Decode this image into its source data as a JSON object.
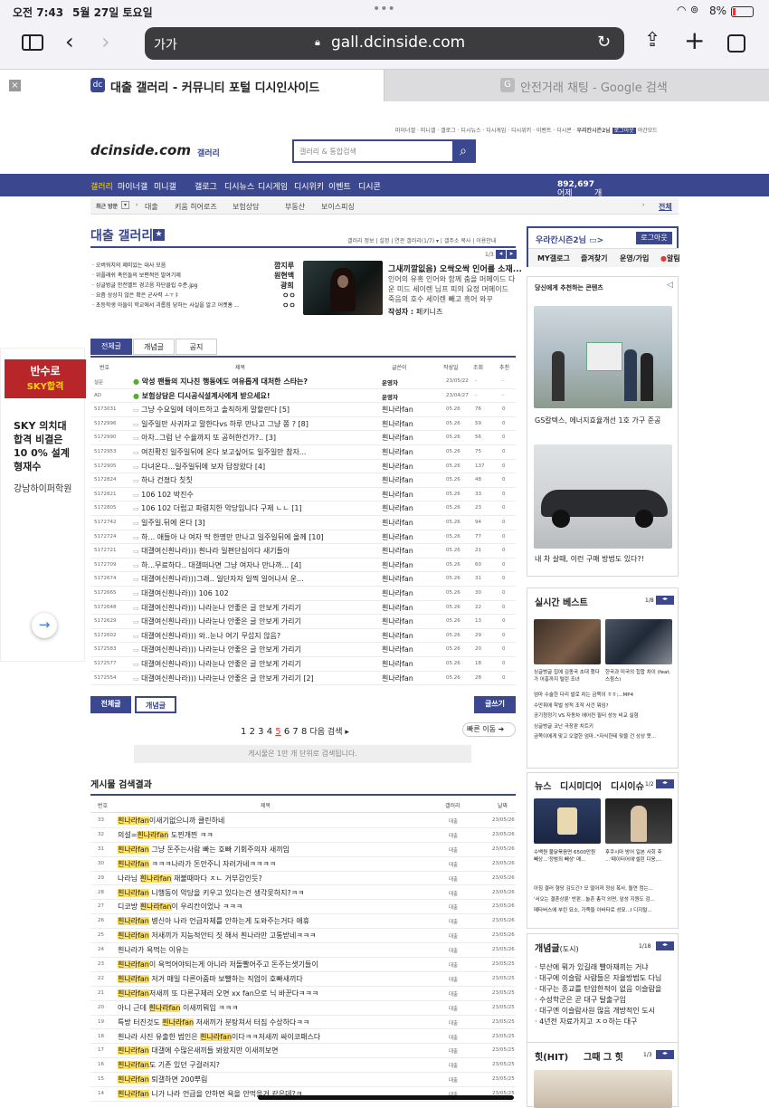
{
  "status": {
    "time": "오전 7:43",
    "date": "5월 27일 토요일",
    "dots": "•••",
    "battery": "8%"
  },
  "browser": {
    "aa": "가가",
    "url": "gall.dcinside.com"
  },
  "tabs": [
    {
      "title": "대출 갤러리 - 커뮤니티 포털 디시인사이드"
    },
    {
      "title": "안전거래 채팅 - Google 검색"
    }
  ],
  "header": {
    "toplinks": [
      "마이너갤",
      "미니갤",
      "갤로그",
      "디시뉴스",
      "디시게임",
      "디시위키",
      "이벤트",
      "디시콘",
      "우리칸시즌2님",
      "로그아웃",
      "야간모드"
    ],
    "logo": "dcinside.com",
    "logo_sub": "갤러리",
    "search_placeholder": "갤러리 & 통합검색"
  },
  "nav": {
    "items": [
      "갤러리",
      "마이너갤",
      "미니갤",
      "갤로그",
      "디시뉴스",
      "디시게임",
      "디시위키",
      "이벤트",
      "디시콘"
    ],
    "today_prefix": "어제",
    "today_count": "892,697",
    "today_suffix": "개 게시글 등록"
  },
  "recent": {
    "label": "최근 방문",
    "items": [
      "대출",
      "키움 히어로즈",
      "보험상담",
      "부동산",
      "보이스피싱"
    ],
    "all": "전체"
  },
  "gallery": {
    "title": "대출 갤러리",
    "links": [
      "갤러리 정보",
      "설정",
      "연관 갤러리(1/7)",
      "갤주소 복사",
      "이용안내"
    ],
    "page": "1/3",
    "issues": [
      {
        "t": "오버워치의 제미있는 대사 모음",
        "a": "깜지루"
      },
      {
        "t": "위플래쉬 촉인들의 보편적인 발여기제",
        "a": "원현맥"
      },
      {
        "t": "싱글벙글 안전벨트 경고음 차단클립 수준.jpg",
        "a": "광희"
      },
      {
        "t": "요즘 상상치 않은 확은 군사력 ㅗㅜㅑ",
        "a": "ㅇㅇ"
      },
      {
        "t": "초등학생 아들이 학교에서 괴롭힘 당하는 사실을 알고 어켓홈 ...",
        "a": "ㅇㅇ"
      }
    ],
    "feature": {
      "title": "그새끼깔잆음) 오싹오싹 인어를 소재...",
      "body": "인어의 유혹 인어와 함께 춤을 머메이드 다운 미드 세이렌 님프 피의 요정 머메이드 죽음의 호수 세이렌 빼고 흑어 와꾸",
      "author_label": "작성자 : ",
      "author": "페키니즈"
    }
  },
  "tabs_list": [
    "전체글",
    "개념글",
    "공지"
  ],
  "cols": [
    "번호",
    "제목",
    "글쓴이",
    "작성일",
    "조회",
    "추천"
  ],
  "posts": [
    {
      "no": "설문",
      "t": "악성 팬들의 지나친 행동에도 여유롭게 대처한 스타는?",
      "w": "운영자",
      "d": "23/05/22",
      "v": "-",
      "r": "-",
      "b": true
    },
    {
      "no": "AD",
      "t": "보험상담은 디시공식설계사에게 받으세요!",
      "w": "운영자",
      "d": "23/04/27",
      "v": "-",
      "r": "-",
      "b": true
    },
    {
      "no": "5173031",
      "t": "그냥 수요일에 데이트하고 솔직하게 말할란다 [5]",
      "w": "흰나라fan",
      "d": "05.26",
      "v": "76",
      "r": "0"
    },
    {
      "no": "5172996",
      "t": "일주일만 사귀자고 말한다vs 하루 만나고 그냥 쫑 ? [8]",
      "w": "흰나라fan",
      "d": "05.26",
      "v": "59",
      "r": "0"
    },
    {
      "no": "5172990",
      "t": "아차..그럼 난 수율까지 또 공허한건가?.. [3]",
      "w": "흰나라fan",
      "d": "05.26",
      "v": "56",
      "r": "0"
    },
    {
      "no": "5172953",
      "t": "여친확진 일주일뒤에 온다 보고싶어도 일주일만 참자...",
      "w": "흰나라fan",
      "d": "05.26",
      "v": "75",
      "r": "0"
    },
    {
      "no": "5172905",
      "t": "다녀온다...일주일뒤에 보자 답장왔다 [4]",
      "w": "흰나라fan",
      "d": "05.26",
      "v": "137",
      "r": "0"
    },
    {
      "no": "5172824",
      "t": "하나 건졌다 칫칫",
      "w": "흰나라fan",
      "d": "05.26",
      "v": "48",
      "r": "0"
    },
    {
      "no": "5172821",
      "t": "106 102 박진수",
      "w": "흰나라fan",
      "d": "05.26",
      "v": "33",
      "r": "0"
    },
    {
      "no": "5172805",
      "t": "106 102 더럽고 파렴치한 악당입니다 구제 ㄴㄴ [1]",
      "w": "흰나라fan",
      "d": "05.26",
      "v": "23",
      "r": "0"
    },
    {
      "no": "5172742",
      "t": "일주일.뒤에 온다 [3]",
      "w": "흰나라fan",
      "d": "05.26",
      "v": "94",
      "r": "0"
    },
    {
      "no": "5172724",
      "t": "하... 애들아 나 여자 딱 한명만 만나고 일주일뒤에 올께 [10]",
      "w": "흰나라fan",
      "d": "05.26",
      "v": "77",
      "r": "0"
    },
    {
      "no": "5172721",
      "t": "대갤여신흰나라))) 흰나라 일편단심이다 새기들아",
      "w": "흰나라fan",
      "d": "05.26",
      "v": "21",
      "r": "0"
    },
    {
      "no": "5172709",
      "t": "하...무료하다.. 대갤떠나면 그냥 여자나 만나까... [4]",
      "w": "흰나라fan",
      "d": "05.26",
      "v": "60",
      "r": "0"
    },
    {
      "no": "5172674",
      "t": "대갤여신흰나라)))그래.. 일단자자 일찍 일어나서 운...",
      "w": "흰나라fan",
      "d": "05.26",
      "v": "31",
      "r": "0"
    },
    {
      "no": "5172665",
      "t": "대갤여신흰나라))) 106 102",
      "w": "흰나라fan",
      "d": "05.26",
      "v": "30",
      "r": "0"
    },
    {
      "no": "5172648",
      "t": "대갤여신흰나라))) 나라눈나 안좋은 글 안보게 가리기",
      "w": "흰나라fan",
      "d": "05.26",
      "v": "22",
      "r": "0"
    },
    {
      "no": "5172629",
      "t": "대갤여신흰나라))) 나라눈나 안좋은 글 안보게 가리기",
      "w": "흰나라fan",
      "d": "05.26",
      "v": "13",
      "r": "0"
    },
    {
      "no": "5172602",
      "t": "대갤여신흰나라))) 와..눈나 여기 무섭지 않음?",
      "w": "흰나라fan",
      "d": "05.26",
      "v": "29",
      "r": "0"
    },
    {
      "no": "5172583",
      "t": "대갤여신흰나라))) 나라눈나 안좋은 글 안보게 가리기",
      "w": "흰나라fan",
      "d": "05.26",
      "v": "20",
      "r": "0"
    },
    {
      "no": "5172577",
      "t": "대갤여신흰나라))) 나라눈나 안좋은 글 안보게 가리기",
      "w": "흰나라fan",
      "d": "05.26",
      "v": "18",
      "r": "0"
    },
    {
      "no": "5172554",
      "t": "대갤여신흰나라))) 나라눈나 안좋은 글 안보게 가리기 [2]",
      "w": "흰나라fan",
      "d": "05.26",
      "v": "28",
      "r": "0"
    }
  ],
  "list_buttons": {
    "all": "전체글",
    "concept": "개념글",
    "write": "글쓰기"
  },
  "pagination": {
    "pages": [
      "1",
      "2",
      "3",
      "4",
      "5",
      "6",
      "7",
      "8"
    ],
    "current": "5",
    "next": "다음 검색 ▸",
    "jump": "빠른 이동"
  },
  "notice": "게시물은 1만 개 단위로 검색됩니다.",
  "search_results": {
    "title": "게시물 검색결과",
    "cols": [
      "번호",
      "제목",
      "갤러리",
      "날짜"
    ],
    "rows": [
      {
        "no": "33",
        "pre": "",
        "hl": "흰나라fan",
        "post": "이새기없으니까 클린하네",
        "g": "대출",
        "d": "23/05/26"
      },
      {
        "no": "32",
        "pre": "의설=",
        "hl": "흰나라fan",
        "post": " 도찐개찐 ㅋㅋ",
        "g": "대출",
        "d": "23/05/26"
      },
      {
        "no": "31",
        "pre": "",
        "hl": "흰나라fan",
        "post": " 그냥 돈주는사람 빠는 호빠 기회주의자 새끼임",
        "g": "대출",
        "d": "23/05/26"
      },
      {
        "no": "30",
        "pre": "",
        "hl": "흰나라fan",
        "post": " ㅋㅋㅋ나라가 돈안주니 자러가네ㅋㅋㅋㅋ",
        "g": "대출",
        "d": "23/05/26"
      },
      {
        "no": "29",
        "pre": "나라님 ",
        "hl": "흰나라fan",
        "post": " 재불때마다 ㅈㄴ 거부감인듯?",
        "g": "대출",
        "d": "23/05/26"
      },
      {
        "no": "28",
        "pre": "",
        "hl": "흰나라fan",
        "post": " 니행동이 악당을 키우고 있다는건 생각못하지?ㅋㅋ",
        "g": "대출",
        "d": "23/05/26"
      },
      {
        "no": "27",
        "pre": "디코방 ",
        "hl": "흰나라fan",
        "post": "이 우리칸이었나 ㅋㅋㅋ",
        "g": "대출",
        "d": "23/05/26"
      },
      {
        "no": "26",
        "pre": "",
        "hl": "흰나라fan",
        "post": " 병신아 나라 언급자체를 안하는게 도와주는거다 애휴",
        "g": "대출",
        "d": "23/05/26"
      },
      {
        "no": "25",
        "pre": "",
        "hl": "흰나라fan",
        "post": " 저새끼가 지능적안티 짓 해서 흰나라만 고통받네ㅋㅋㅋ",
        "g": "대출",
        "d": "23/05/26"
      },
      {
        "no": "24",
        "pre": "흰나라가 욕먹는 이유는",
        "hl": "",
        "post": "",
        "g": "대출",
        "d": "23/05/26"
      },
      {
        "no": "23",
        "pre": "",
        "hl": "흰나라fan",
        "post": "이 욕먹어야되는게 아니라 저돌빨어주고 돈주는샛기들이",
        "g": "대출",
        "d": "23/05/25"
      },
      {
        "no": "22",
        "pre": "",
        "hl": "흰나라fan",
        "post": " 저거 매일 다른아줌마 보빨하는 직업이 호빠새끼다",
        "g": "대출",
        "d": "23/05/25"
      },
      {
        "no": "21",
        "pre": "",
        "hl": "흰나라fan",
        "post": "저새끼 또 다른구제러 오면 xx fan으로 닉 바꾼다ㅋㅋㅋ",
        "g": "대출",
        "d": "23/05/25"
      },
      {
        "no": "20",
        "pre": "아니 근데 ",
        "hl": "흰나라fan",
        "post": " 이새끼뭐임 ㅋㅋㅋ",
        "g": "대출",
        "d": "23/05/25"
      },
      {
        "no": "19",
        "pre": "특방 터진것도 ",
        "hl": "흰나라fan",
        "post": " 저새끼가 분탕쳐서 터짐 수상하다ㅋㅋ",
        "g": "대출",
        "d": "23/05/25"
      },
      {
        "no": "18",
        "pre": "흰나라 사진 유출한 범인은 ",
        "hl": "흰나라fan",
        "post": "이다ㅋㅋ저새끼 싸이코패스다",
        "g": "대출",
        "d": "23/05/25"
      },
      {
        "no": "17",
        "pre": "",
        "hl": "흰나라fan",
        "post": " 대갤에 수많은새끼들 봐왔지만 이새끼보면",
        "g": "대출",
        "d": "23/05/25"
      },
      {
        "no": "16",
        "pre": "",
        "hl": "흰나라fan",
        "post": "도 기존 있던 구걸러지?",
        "g": "대출",
        "d": "23/05/25"
      },
      {
        "no": "15",
        "pre": "",
        "hl": "흰나라fan",
        "post": " 퇴갤하면 200뿌림",
        "g": "대출",
        "d": "23/05/25"
      },
      {
        "no": "14",
        "pre": "",
        "hl": "흰나라fan",
        "post": " 니가 나라 언급을 안하면 욕을 안먹을거 같은데?ㅋ",
        "g": "대출",
        "d": "23/05/25"
      }
    ]
  },
  "left_ad": {
    "badge1": "반수로",
    "badge2": "SKY합격",
    "text": "SKY 의치대 합격 비결은 10 0% 설계형재수",
    "sub": "강남하이퍼학원"
  },
  "sidebar": {
    "user": "우라칸시즌2님",
    "logout": "로그아웃",
    "tabs": [
      "MY갤로그",
      "즐겨찾기",
      "운영/가입",
      "알림"
    ],
    "rec_title": "당신에게 추천하는 콘텐츠",
    "rec1": "GS칼텍스, 에너지효율개선 1호 가구 준공",
    "rec2": "내 차 살때, 이런 구매 방법도 있다?!",
    "best_title": "실시간 베스트",
    "best_page": "1/8",
    "best_caps": [
      "싱글벙글 집에 김종국 초대 했다가 어흥까지 털린 조녀",
      "한국과 미국의 힙합 차이 (feat. 스윙스)"
    ],
    "best_list": [
      "엄마 수술한 다리 발로 차는 금쪽이 ㅎㅎ;...MP4",
      "수만휘에 학벌 성적 조작 사건 뭐임?",
      "공기청정기 VS 자동차 에어컨 필터 성능 비교 실험",
      "싱글벙글 코난 극장판 치트키",
      "금쪽이에게 맞고 오열한 엄마..*자식한테 맞을 건 상상 못..."
    ],
    "news_tabs": [
      "뉴스",
      "디시미디어",
      "디시이슈"
    ],
    "news_page": "1/2",
    "news_caps": [
      "수백원 불닭볶음면 6500만원 빼상...'정범죄 빼상' 매...",
      "후쿠시마 방어 일본 사회 후 ...'때이터어에'셀린 디옹,..."
    ],
    "news_list": [
      "아침 결러 형당 김도긴? 모 떨어져 정심 폭사, 돌연 컴는...",
      "'서오는 결혼상륜' 반판...놀촌 총각 외면, 앞성 지원도 검...",
      "메타버스에 부린 묘소, 가족들 아바타로 성묘...I 디지털..."
    ],
    "concept_title": "개념글",
    "concept_sub": "(도시)",
    "concept_page": "1/18",
    "concept_list": [
      "부산에 뭐가 있길래 빨아재끼는 거냐",
      "대구에 이슬람 사람들은 자율방범도 다님",
      "대구는 종교를 탄압한적이 없음 이슬람을",
      "수성학군은 곧 대구 탈출구임",
      "대구엔 이슬람사원 많음 개방적인 도시",
      "4년전 자료가지고 ㅈㅇ하는 대구"
    ],
    "hit_tabs": [
      "힛(HIT)",
      "그때 그 힛"
    ],
    "hit_page": "1/3"
  },
  "colors": {
    "nav": "#3b4890",
    "highlight": "#ffe066",
    "accent": "#e53935"
  }
}
